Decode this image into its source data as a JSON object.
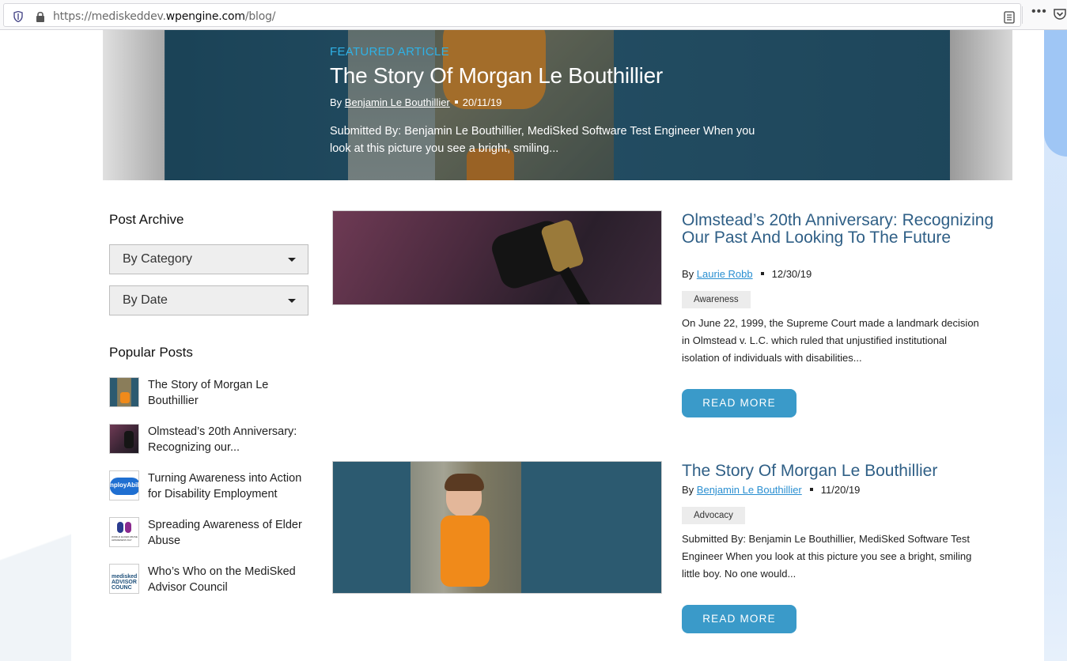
{
  "browser": {
    "url_prefix": "https://medisked",
    "url_dev": "dev.",
    "url_domain": "wpengine.com",
    "url_path": "/blog/",
    "menu_dots": "•••"
  },
  "hero": {
    "label": "FEATURED ARTICLE",
    "title": "The Story Of Morgan Le Bouthillier",
    "by": "By",
    "author": "Benjamin Le Bouthillier",
    "date": "20/11/19",
    "excerpt": "Submitted By: Benjamin Le Bouthillier, MediSked Software Test Engineer When you look at this picture you see a bright, smiling..."
  },
  "sidebar": {
    "archive_heading": "Post Archive",
    "category_select": "By Category",
    "date_select": "By Date",
    "popular_heading": "Popular Posts",
    "popular": [
      {
        "label": "The Story of Morgan Le Bouthillier"
      },
      {
        "label": "Olmstead’s 20th Anniversary: Recognizing our..."
      },
      {
        "label": "Turning Awareness into Action for Disability Employment",
        "thumb_text": "nployAbili"
      },
      {
        "label": "Spreading Awareness of Elder Abuse",
        "thumb_text": "WORLD ELDER ABUSE AWARENESS DAY"
      },
      {
        "label": "Who’s Who on the MediSked Advisor Council",
        "thumb_text": "medisked ADVISOR COUNC"
      }
    ]
  },
  "articles": [
    {
      "title": "Olmstead’s 20th Anniversary: Recognizing Our Past And Looking To The Future",
      "by": "By",
      "author": "Laurie Robb",
      "date": "12/30/19",
      "tag": "Awareness",
      "excerpt": "On June 22, 1999, the Supreme Court made a landmark decision in Olmstead v. L.C. which ruled that unjustified institutional isolation of individuals with disabilities...",
      "button": "READ MORE"
    },
    {
      "title": "The Story Of Morgan Le Bouthillier",
      "by": "By",
      "author": "Benjamin Le Bouthillier",
      "date": "11/20/19",
      "tag": "Advocacy",
      "excerpt": "Submitted By: Benjamin Le Bouthillier, MediSked Software Test Engineer When you look at this picture you see a bright, smiling little boy. No one would...",
      "button": "READ MORE"
    }
  ],
  "colors": {
    "accent": "#3a9ac9",
    "title_blue": "#2f5f86",
    "featured_label": "#2fb1e6",
    "link": "#2a8fd1"
  }
}
